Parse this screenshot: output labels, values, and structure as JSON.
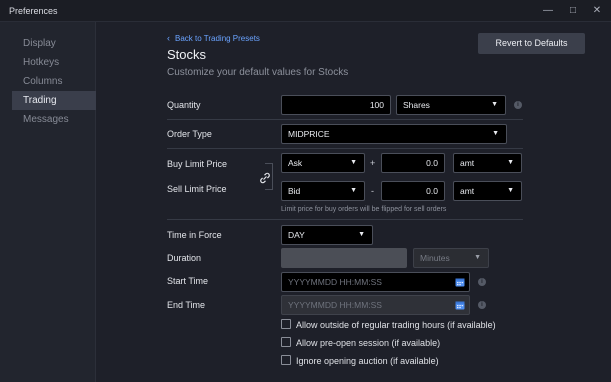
{
  "window": {
    "title": "Preferences"
  },
  "icons": {
    "minimize": "minimize-icon",
    "maximize": "maximize-icon",
    "close": "close-icon",
    "back": "chevron-left-icon",
    "link": "link-icon",
    "calendar": "calendar-icon",
    "info": "info-icon",
    "dropdown": "chevron-down-icon"
  },
  "sidebar": {
    "items": [
      {
        "label": "Display"
      },
      {
        "label": "Hotkeys"
      },
      {
        "label": "Columns"
      },
      {
        "label": "Trading",
        "active": true
      },
      {
        "label": "Messages"
      }
    ]
  },
  "header": {
    "back_label": "Back to Trading Presets",
    "revert_label": "Revert to Defaults",
    "title": "Stocks",
    "subtitle": "Customize your default values for Stocks"
  },
  "form": {
    "quantity": {
      "label": "Quantity",
      "value": "100",
      "unit": "Shares"
    },
    "order_type": {
      "label": "Order Type",
      "value": "MIDPRICE"
    },
    "buy_limit": {
      "label": "Buy Limit Price",
      "base": "Ask",
      "operator": "+",
      "offset": "0.0",
      "unit": "amt"
    },
    "sell_limit": {
      "label": "Sell Limit Price",
      "base": "Bid",
      "operator": "-",
      "offset": "0.0",
      "unit": "amt"
    },
    "limit_note": "Limit price for buy orders will be flipped for sell orders",
    "time_in_force": {
      "label": "Time in Force",
      "value": "DAY"
    },
    "duration": {
      "label": "Duration",
      "value": "",
      "unit": "Minutes"
    },
    "start_time": {
      "label": "Start Time",
      "placeholder": "YYYYMMDD HH:MM:SS"
    },
    "end_time": {
      "label": "End Time",
      "placeholder": "YYYYMMDD HH:MM:SS"
    },
    "checkboxes": [
      {
        "label": "Allow outside of regular trading hours (if available)",
        "checked": false
      },
      {
        "label": "Allow pre-open session (if available)",
        "checked": false
      },
      {
        "label": "Ignore opening auction (if available)",
        "checked": false
      }
    ]
  },
  "colors": {
    "accent": "#6aa3ff",
    "background": "#1e2029",
    "sidebar_active": "#3a3e4b"
  }
}
